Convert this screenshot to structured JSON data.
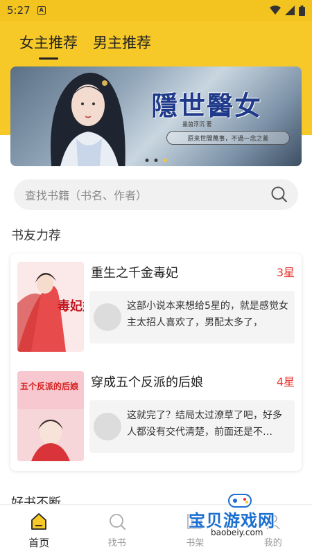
{
  "status_bar": {
    "time": "5:27",
    "app_icon": "A"
  },
  "tabs": [
    {
      "label": "女主推荐",
      "active": true
    },
    {
      "label": "男主推荐",
      "active": false
    }
  ],
  "banner": {
    "title": "隱世醫女",
    "author": "墨茵浮沉 著",
    "subtitle": "原来世間萬事，不過一念之差",
    "dot_count": 3,
    "active_dot": 2
  },
  "search": {
    "placeholder": "查找书籍（书名、作者）"
  },
  "sections": {
    "recommend_title": "书友力荐",
    "good_books_title": "好书不断"
  },
  "books": [
    {
      "title": "重生之千金毒妃",
      "rating": "3星",
      "cover_text": "毒妃娇",
      "review": "这部小说本来想给5星的，就是感觉女主太招人喜欢了，男配太多了，"
    },
    {
      "title": "穿成五个反派的后娘",
      "rating": "4星",
      "cover_text": "五个反派的后娘",
      "review": "这就完了？结局太过潦草了吧，好多人都没有交代清楚，前面还是不…"
    }
  ],
  "bottom_nav": [
    {
      "label": "首页",
      "icon": "home-icon",
      "active": true
    },
    {
      "label": "找书",
      "icon": "search-icon",
      "active": false
    },
    {
      "label": "书架",
      "icon": "bookshelf-icon",
      "active": false
    },
    {
      "label": "我的",
      "icon": "profile-icon",
      "active": false
    }
  ],
  "watermark": {
    "text": "宝贝游戏网",
    "url": "baobeiy.com"
  },
  "colors": {
    "accent": "#f6c928",
    "rating": "#e8322c"
  }
}
